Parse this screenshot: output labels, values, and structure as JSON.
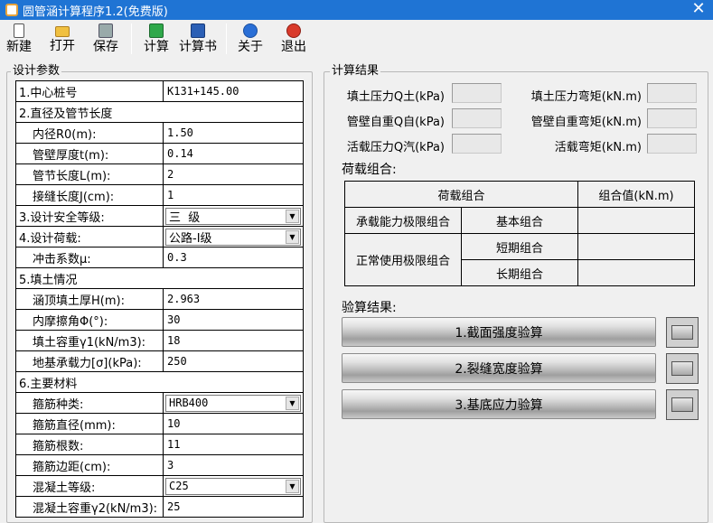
{
  "window": {
    "title": "圆管涵计算程序1.2(免费版)",
    "close_glyph": "✕"
  },
  "toolbar": {
    "new": "新建",
    "open": "打开",
    "save": "保存",
    "calc": "计算",
    "report": "计算书",
    "about": "关于",
    "exit": "退出"
  },
  "design": {
    "group_title": "设计参数",
    "center_pile_label": "1.中心桩号",
    "center_pile_value": "K131+145.00",
    "sec2": "2.直径及管节长度",
    "inner_r_label": "内径R0(m):",
    "inner_r_value": "1.50",
    "wall_t_label": "管壁厚度t(m):",
    "wall_t_value": "0.14",
    "seg_len_label": "管节长度L(m):",
    "seg_len_value": "2",
    "joint_len_label": "接缝长度J(cm):",
    "joint_len_value": "1",
    "safety_label": "3.设计安全等级:",
    "safety_value": "三  级",
    "load_label": "4.设计荷载:",
    "load_value": "公路-Ⅰ级",
    "impact_label": "冲击系数μ:",
    "impact_value": "0.3",
    "sec5": "5.填土情况",
    "fill_h_label": "涵顶填土厚H(m):",
    "fill_h_value": "2.963",
    "friction_label": "内摩擦角Φ(°):",
    "friction_value": "30",
    "gamma1_label": "填土容重γ1(kN/m3):",
    "gamma1_value": "18",
    "bearing_label": "地基承载力[σ](kPa):",
    "bearing_value": "250",
    "sec6": "6.主要材料",
    "rebar_type_label": "箍筋种类:",
    "rebar_type_value": "HRB400",
    "rebar_dia_label": "箍筋直径(mm):",
    "rebar_dia_value": "10",
    "rebar_cnt_label": "箍筋根数:",
    "rebar_cnt_value": "11",
    "rebar_edge_label": "箍筋边距(cm):",
    "rebar_edge_value": "3",
    "concrete_label": "混凝土等级:",
    "concrete_value": "C25",
    "gamma2_label": "混凝土容重γ2(kN/m3):",
    "gamma2_value": "25"
  },
  "results": {
    "group_title": "计算结果",
    "fill_p": "填土压力Q土(kPa)",
    "fill_m": "填土压力弯矩(kN.m)",
    "wall_w": "管壁自重Q自(kPa)",
    "wall_m": "管壁自重弯矩(kN.m)",
    "live_p": "活载压力Q汽(kPa)",
    "live_m": "活载弯矩(kN.m)",
    "load_combo_title": "荷载组合:",
    "combo_header": "荷载组合",
    "combo_value_header": "组合值(kN.m)",
    "ult_label": "承载能力极限组合",
    "basic": "基本组合",
    "svc_label": "正常使用极限组合",
    "short": "短期组合",
    "long": "长期组合",
    "check_title": "验算结果:",
    "check1": "1.截面强度验算",
    "check2": "2.裂缝宽度验算",
    "check3": "3.基底应力验算"
  }
}
